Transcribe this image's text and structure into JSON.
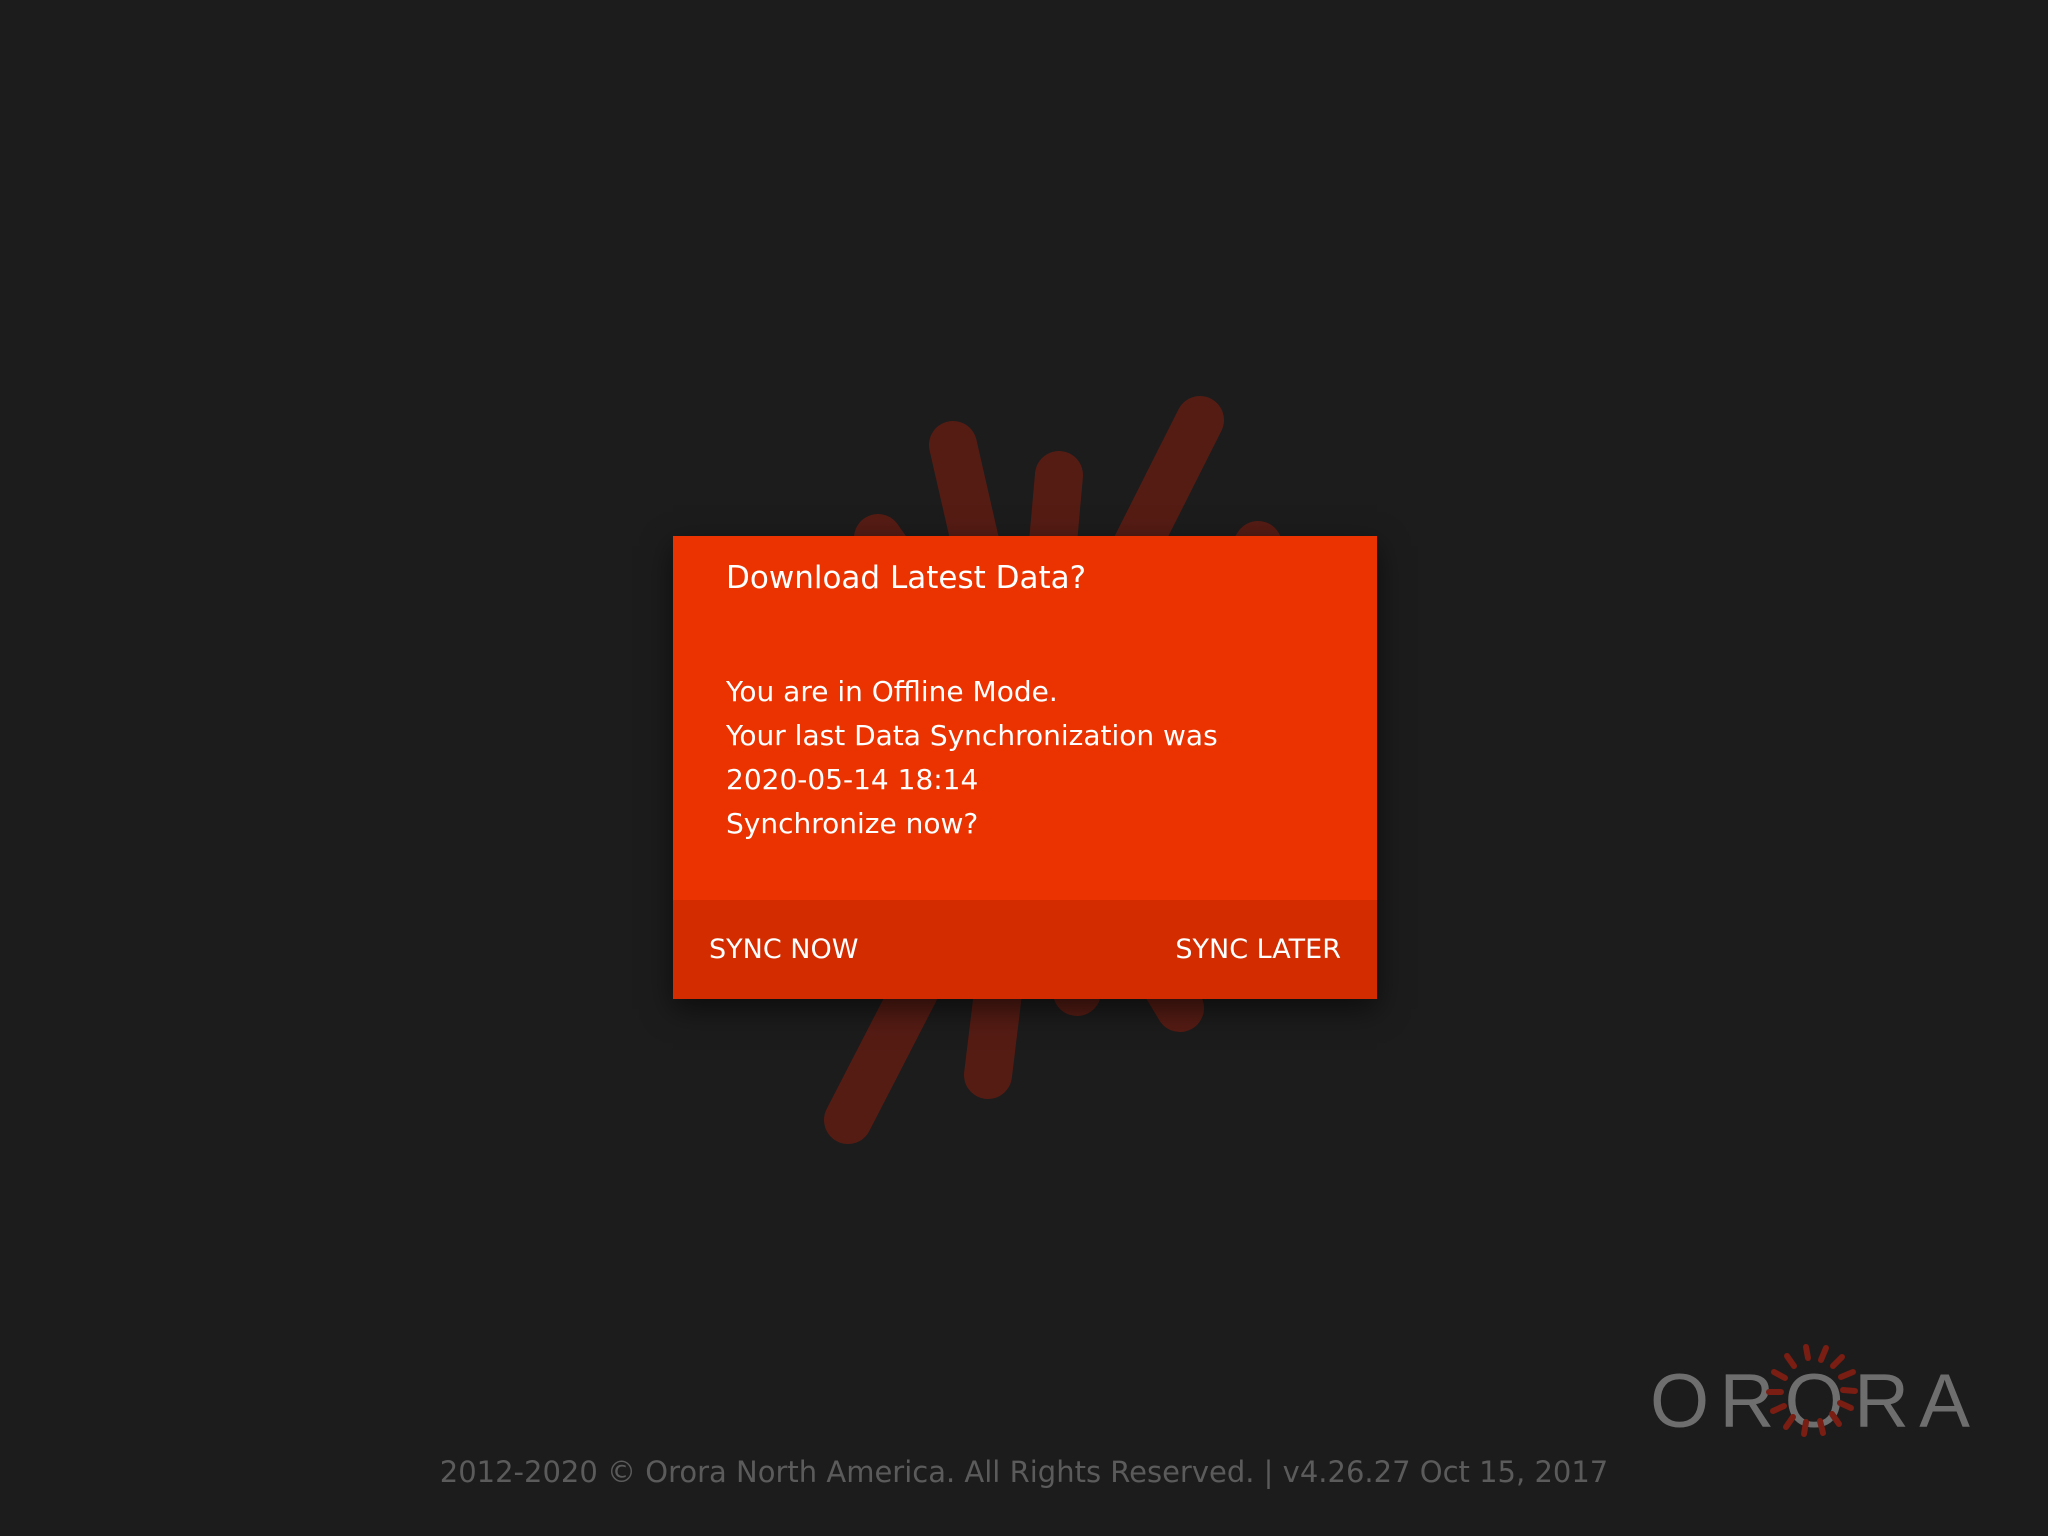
{
  "dialog": {
    "title": "Download Latest Data?",
    "body_lines": [
      "You are in Offline Mode.",
      "Your last Data Synchronization was",
      "2020-05-14 18:14",
      "Synchronize now?"
    ],
    "primary_action": "SYNC NOW",
    "secondary_action": "SYNC LATER"
  },
  "logo": {
    "text": "ORORA",
    "icon": "orora-sunburst-logo"
  },
  "footer": {
    "text": "2012-2020 © Orora North America. All Rights Reserved. | v4.26.27 Oct 15, 2017"
  },
  "colors": {
    "background": "#1c1c1c",
    "dialog": "#ea3300",
    "dialog_actions": "#d32c00",
    "splash_rays": "#551c14",
    "logo_text": "#6e6e6e",
    "logo_rays": "#7a1d12",
    "footer_text": "#5b5b5b"
  }
}
